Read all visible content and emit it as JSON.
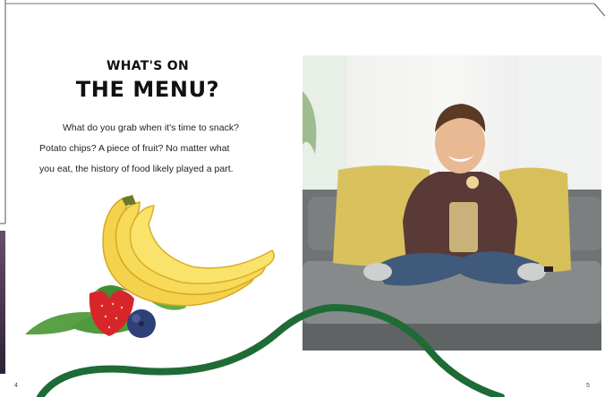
{
  "heading": {
    "line1": "WHAT'S ON",
    "line2": "THE MENU?"
  },
  "body": {
    "line1": "What do you grab when it's time to snack?",
    "line2": "Potato chips? A piece of fruit? No matter what",
    "line3": "you eat, the history of food likely played a part."
  },
  "pages": {
    "left": "4",
    "right": "5"
  },
  "icons": {
    "fruit": "bananas-strawberry-blueberry-illustration",
    "photo": "boy-eating-chips-on-couch-photo"
  },
  "colors": {
    "wave": "#1e6b36",
    "text": "#111111"
  }
}
